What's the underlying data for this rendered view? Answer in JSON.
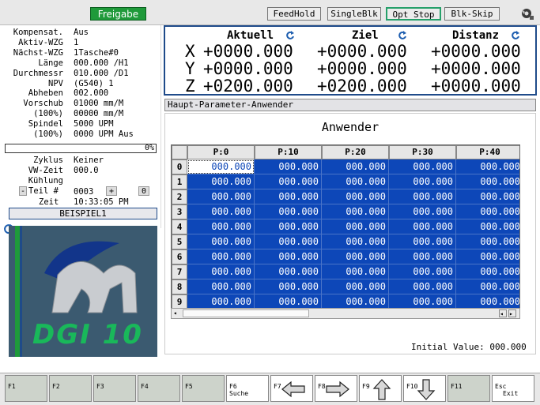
{
  "toolbar": {
    "freigabe": "Freigabe",
    "buttons": [
      "FeedHold",
      "SingleBlk",
      "Opt Stop",
      "Blk-Skip"
    ]
  },
  "status": {
    "rows": [
      {
        "label": "Kompensat.",
        "value": "Aus"
      },
      {
        "label": "Aktiv-WZG",
        "value": "1"
      },
      {
        "label": "Nächst-WZG",
        "value": "1Tasche#0"
      },
      {
        "label": "Länge",
        "value": "000.000 /H1"
      },
      {
        "label": "Durchmessr",
        "value": "010.000 /D1"
      },
      {
        "label": "NPV",
        "value": "(G540) 1"
      },
      {
        "label": "Abheben",
        "value": "002.000"
      },
      {
        "label": "Vorschub",
        "value": "01000 mm/M"
      },
      {
        "label": "(100%)",
        "value": "00000 mm/M"
      },
      {
        "label": "Spindel",
        "value": "5000 UPM"
      },
      {
        "label": "(100%)",
        "value": "0000 UPM Aus"
      }
    ],
    "progress_label": "0%",
    "progress": 0,
    "rows2": [
      {
        "label": "Zyklus",
        "value": "Keiner"
      },
      {
        "label": "VW-Zeit",
        "value": "000.0"
      },
      {
        "label": "Kühlung",
        "value": ""
      }
    ],
    "part_minus": "-",
    "part_label": "Teil #",
    "part_value": "0003",
    "part_plus": "+",
    "part_zero": "0",
    "time_label": "Zeit",
    "time_value": "10:33:05 PM",
    "program_name": "BEISPIEL1",
    "logo_text": "DGI 10"
  },
  "coords": {
    "headers": [
      "Aktuell",
      "Ziel",
      "Distanz"
    ],
    "axes": [
      {
        "axis": "X",
        "values": [
          "+0000.000",
          "+0000.000",
          "+0000.000"
        ]
      },
      {
        "axis": "Y",
        "values": [
          "+0000.000",
          "+0000.000",
          "+0000.000"
        ]
      },
      {
        "axis": "Z",
        "values": [
          "+0200.000",
          "+0200.000",
          "+0000.000"
        ]
      }
    ]
  },
  "panel": {
    "title": "Haupt-Parameter-Anwender",
    "heading": "Anwender",
    "columns": [
      "P:0",
      "P:10",
      "P:20",
      "P:30",
      "P:40"
    ],
    "rows": [
      "0",
      "1",
      "2",
      "3",
      "4",
      "5",
      "6",
      "7",
      "8",
      "9"
    ],
    "cell_value": "000.000",
    "initial_value": "Initial Value: 000.000"
  },
  "fkeys": [
    {
      "key": "F1",
      "label": ""
    },
    {
      "key": "F2",
      "label": ""
    },
    {
      "key": "F3",
      "label": ""
    },
    {
      "key": "F4",
      "label": ""
    },
    {
      "key": "F5",
      "label": ""
    },
    {
      "key": "F6",
      "label": "Suche"
    },
    {
      "key": "F7",
      "label": "",
      "icon": "arrow-left-icon"
    },
    {
      "key": "F8",
      "label": "",
      "icon": "arrow-right-icon"
    },
    {
      "key": "F9",
      "label": "",
      "icon": "arrow-up-icon"
    },
    {
      "key": "F10",
      "label": "",
      "icon": "arrow-down-icon"
    },
    {
      "key": "F11",
      "label": ""
    },
    {
      "key": "Esc",
      "label": "Exit"
    }
  ],
  "colors": {
    "accent": "#1f4b8a",
    "cell": "#0d47b8",
    "freigabe": "#1f9a3a",
    "optstop": "#26a06a"
  }
}
